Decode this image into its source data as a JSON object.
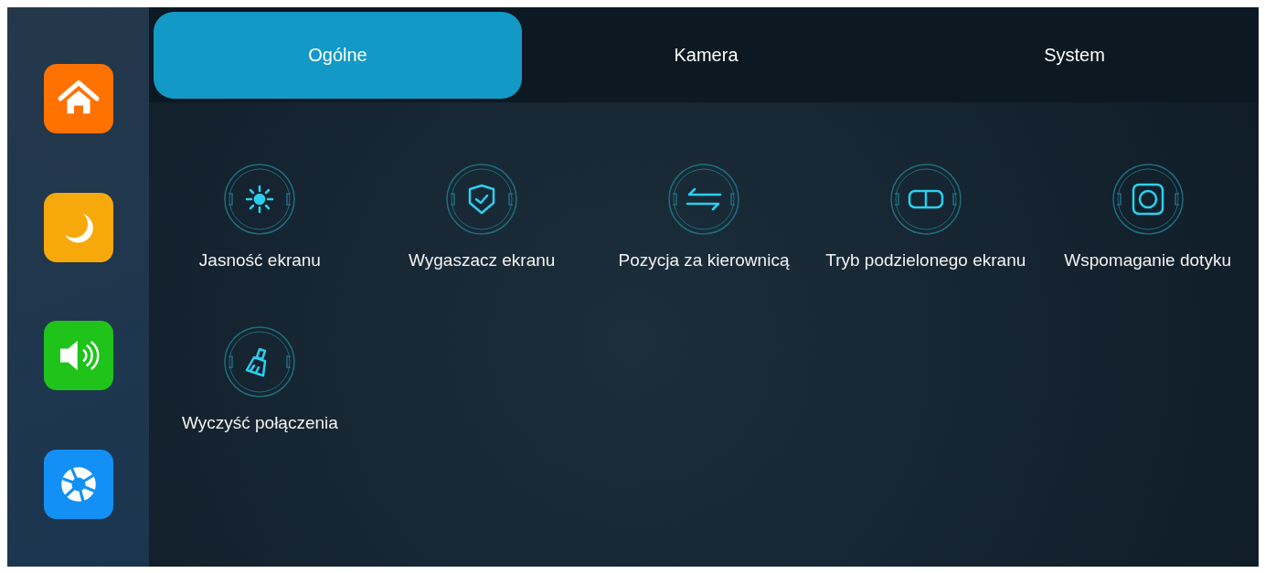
{
  "sidebar": {
    "items": [
      {
        "kind": "home",
        "color": "#ff7200",
        "selected": false
      },
      {
        "kind": "night",
        "color": "#f7a90c",
        "selected": false
      },
      {
        "kind": "sound",
        "color": "#1fc31a",
        "selected": false
      },
      {
        "kind": "aperture",
        "color": "#1290f5",
        "selected": false
      }
    ]
  },
  "tabs": [
    {
      "label": "Ogólne",
      "selected": true
    },
    {
      "label": "Kamera",
      "selected": false
    },
    {
      "label": "System",
      "selected": false
    }
  ],
  "settings": [
    {
      "kind": "brightness",
      "label": "Jasność ekranu"
    },
    {
      "kind": "shield",
      "label": "Wygaszacz ekranu"
    },
    {
      "kind": "swap",
      "label": "Pozycja za kierownicą"
    },
    {
      "kind": "split",
      "label": "Tryb podzielonego ekranu"
    },
    {
      "kind": "touch",
      "label": "Wspomaganie dotyku"
    },
    {
      "kind": "broom",
      "label": "Wyczyść połączenia"
    }
  ]
}
